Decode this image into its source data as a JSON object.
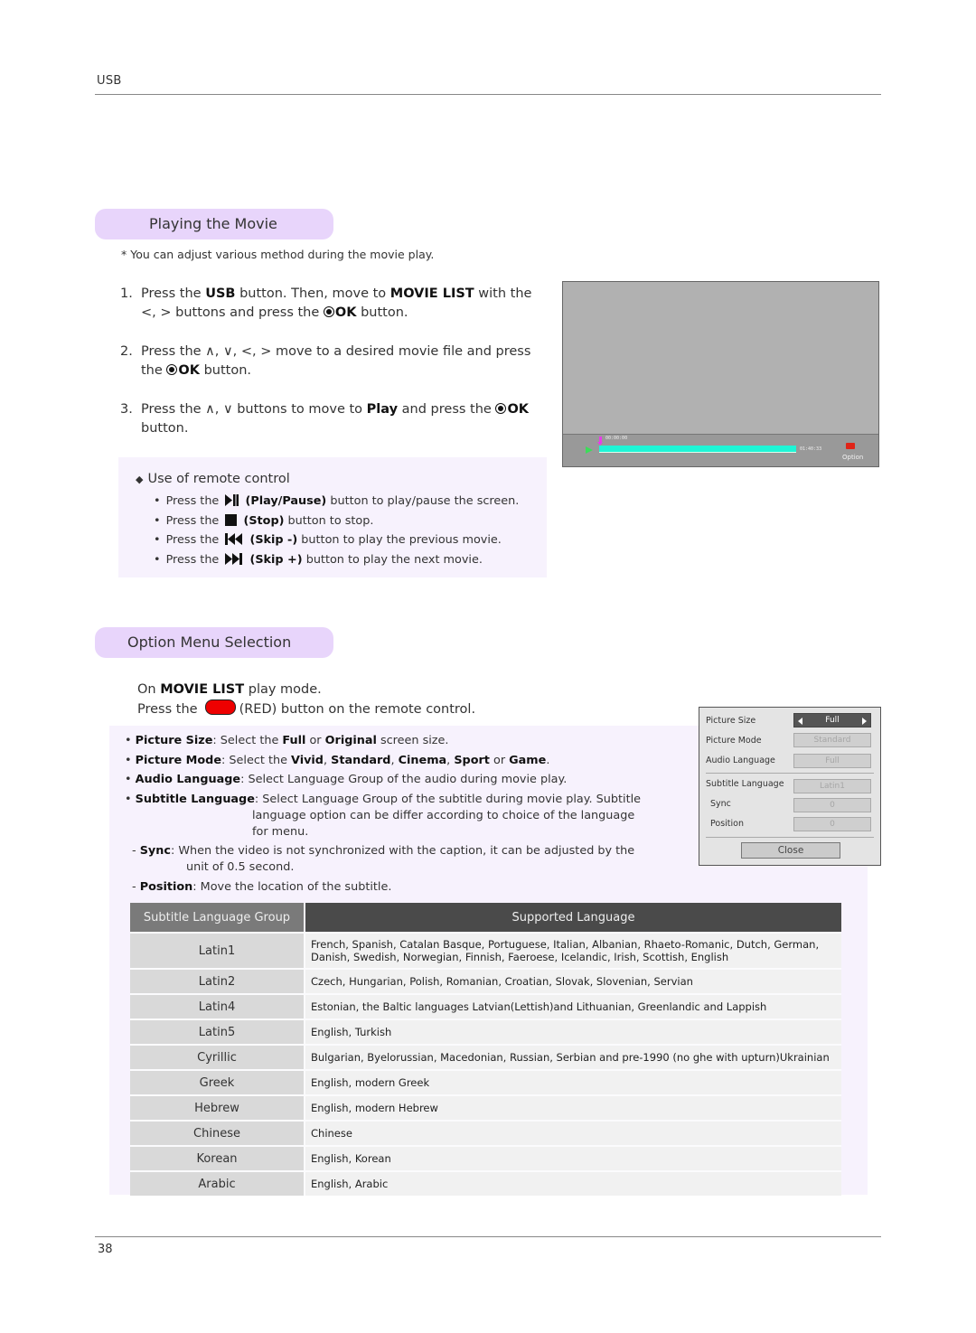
{
  "header": {
    "section": "USB",
    "page_number": "38"
  },
  "playing": {
    "title": "Playing the Movie",
    "note": "* You can adjust various method during the movie play.",
    "steps": [
      {
        "num": "1.",
        "parts": [
          "Press the ",
          "USB",
          " button. Then, move to ",
          "MOVIE LIST",
          " with the <, > buttons and press the ",
          "OK",
          " button."
        ]
      },
      {
        "num": "2.",
        "parts": [
          "Press the ∧, ∨, <, >  move to a desired movie file and press the ",
          "OK",
          " button."
        ]
      },
      {
        "num": "3.",
        "parts": [
          "Press the ∧, ∨  buttons to move to ",
          "Play",
          " and press the ",
          "OK",
          " button."
        ]
      }
    ],
    "remote": {
      "title": "Use of remote control",
      "items": [
        {
          "prefix": "Press the",
          "icon": "play-pause-icon",
          "label": "(Play/Pause)",
          "suffix": "button to play/pause the screen."
        },
        {
          "prefix": "Press the",
          "icon": "stop-icon",
          "label": "(Stop)",
          "suffix": "button to stop."
        },
        {
          "prefix": "Press the",
          "icon": "skip-back-icon",
          "label": "(Skip -)",
          "suffix": "button to play the previous movie."
        },
        {
          "prefix": "Press the",
          "icon": "skip-forward-icon",
          "label": "(Skip +)",
          "suffix": "button to play the next movie."
        }
      ]
    },
    "tv_screen": {
      "current_time": "00:00:00",
      "total_time": "01:40:33",
      "progress_percent": 0,
      "option_label": "Option",
      "colors": {
        "progress": "#1ef5d6",
        "marker": "#e93ce9",
        "play": "#3ddc5a",
        "option_button": "#e02418"
      }
    }
  },
  "option_menu": {
    "title": "Option Menu Selection",
    "intro_line1_prefix": "On ",
    "intro_line1_bold": "MOVIE LIST",
    "intro_line1_suffix": " play mode.",
    "intro_line2_prefix": "Press the",
    "intro_line2_suffix": "(RED) button on the remote control.",
    "red_button_color": "#ee0000",
    "descriptions": {
      "picture_size": {
        "label": "Picture Size",
        "text1": ": Select the ",
        "b1": "Full",
        "text2": " or ",
        "b2": "Original",
        "text3": " screen size."
      },
      "picture_mode": {
        "label": "Picture Mode",
        "text1": ": Select the ",
        "b1": "Vivid",
        "b2": "Standard",
        "b3": "Cinema",
        "b4": "Sport",
        "b5": "Game"
      },
      "audio_language": {
        "label": "Audio Language",
        "text": ": Select Language Group of the audio during movie play."
      },
      "subtitle_language": {
        "label": "Subtitle Language",
        "text1": ": Select Language Group of the subtitle during movie play. Subtitle",
        "text2": "language option can be differ according to choice of the language",
        "text3": "for menu."
      },
      "sync": {
        "label": "Sync",
        "text1": ": When the video is not synchronized with the caption, it can be adjusted by the",
        "text2": "unit of 0.5 second."
      },
      "position": {
        "label": "Position",
        "text": ": Move the location of the subtitle."
      }
    },
    "menu_panel": {
      "rows": [
        {
          "label": "Picture Size",
          "value": "Full"
        },
        {
          "label": "Picture Mode",
          "value": "Standard"
        },
        {
          "label": "Audio Language",
          "value": "Full"
        },
        {
          "label": "Subtitle Language",
          "value": "Latin1"
        },
        {
          "label": "Sync",
          "value": "0"
        },
        {
          "label": "Position",
          "value": "0"
        }
      ],
      "close_label": "Close"
    }
  },
  "language_table": {
    "headers": [
      "Subtitle Language Group",
      "Supported Language"
    ],
    "rows": [
      {
        "group": "Latin1",
        "languages": "French, Spanish, Catalan Basque, Portuguese, Italian, Albanian, Rhaeto-Romanic, Dutch, German, Danish, Swedish, Norwegian, Finnish, Faeroese, Icelandic, Irish, Scottish, English"
      },
      {
        "group": "Latin2",
        "languages": "Czech, Hungarian, Polish, Romanian, Croatian, Slovak, Slovenian, Servian"
      },
      {
        "group": "Latin4",
        "languages": "Estonian, the Baltic languages Latvian(Lettish)and Lithuanian, Greenlandic and Lappish"
      },
      {
        "group": "Latin5",
        "languages": "English, Turkish"
      },
      {
        "group": "Cyrillic",
        "languages": "Bulgarian, Byelorussian, Macedonian, Russian, Serbian and pre-1990 (no ghe with upturn)Ukrainian"
      },
      {
        "group": "Greek",
        "languages": "English, modern Greek"
      },
      {
        "group": "Hebrew",
        "languages": "English, modern Hebrew"
      },
      {
        "group": "Chinese",
        "languages": "Chinese"
      },
      {
        "group": "Korean",
        "languages": "English, Korean"
      },
      {
        "group": "Arabic",
        "languages": "English, Arabic"
      }
    ]
  }
}
